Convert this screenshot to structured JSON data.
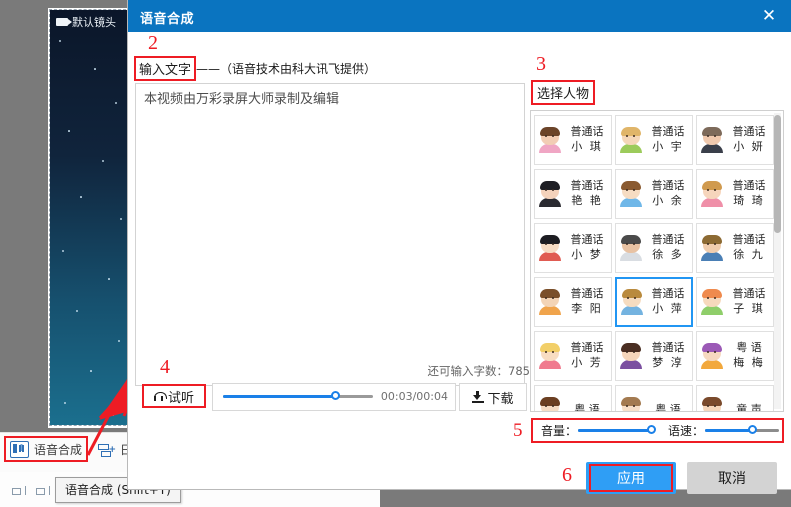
{
  "background": {
    "camera_label": "默认镜头",
    "toolbar": {
      "tts_label": "语音合成",
      "subtitle_label": "日",
      "tooltip": "语音合成 (Shift+T)"
    }
  },
  "dialog": {
    "title": "语音合成",
    "close_icon": "✕",
    "markers": {
      "m2": "2",
      "m3": "3",
      "m4": "4",
      "m5": "5",
      "m6": "6"
    },
    "input_section": {
      "label": "输入文字",
      "label_rest": "——（语音技术由科大讯飞提供）",
      "text_value": "本视频由万彩录屏大师录制及编辑",
      "placeholder": "",
      "char_count_label": "还可输入字数：785"
    },
    "audio": {
      "preview_label": "试听",
      "time_text": "00:03/00:04",
      "download_label": "下载",
      "seek_percent": 75
    },
    "character_section": {
      "label": "选择人物",
      "selected": "小萍",
      "items": [
        {
          "lang": "普通话",
          "name": "小 琪",
          "skin": "#f2cdb5",
          "hair": "#6b4429",
          "cloth": "#f0a6c4",
          "sel": false
        },
        {
          "lang": "普通话",
          "name": "小 宇",
          "skin": "#f5d7b8",
          "hair": "#e0b569",
          "cloth": "#9ccb5b",
          "sel": false
        },
        {
          "lang": "普通话",
          "name": "小 妍",
          "skin": "#f0c9ae",
          "hair": "#7d6a5a",
          "cloth": "#3a3f4a",
          "sel": false
        },
        {
          "lang": "普通话",
          "name": "艳 艳",
          "skin": "#f4d2bb",
          "hair": "#1e1e24",
          "cloth": "#2a2a30",
          "sel": false
        },
        {
          "lang": "普通话",
          "name": "小 余",
          "skin": "#f6dcc2",
          "hair": "#8a5a30",
          "cloth": "#6fb7e8",
          "sel": false
        },
        {
          "lang": "普通话",
          "name": "琦 琦",
          "skin": "#f6d5bc",
          "hair": "#d09a4e",
          "cloth": "#ef8fa8",
          "sel": false
        },
        {
          "lang": "普通话",
          "name": "小 梦",
          "skin": "#f7dcc4",
          "hair": "#1d1d22",
          "cloth": "#e05b52",
          "sel": false
        },
        {
          "lang": "普通话",
          "name": "徐 多",
          "skin": "#e8c2a3",
          "hair": "#4a4a4a",
          "cloth": "#d9dde2",
          "sel": false
        },
        {
          "lang": "普通话",
          "name": "徐 九",
          "skin": "#f0cdae",
          "hair": "#8c6a33",
          "cloth": "#4a7fb5",
          "sel": false
        },
        {
          "lang": "普通话",
          "name": "李 阳",
          "skin": "#f3d4b6",
          "hair": "#7a4f2a",
          "cloth": "#f0a44c",
          "sel": false
        },
        {
          "lang": "普通话",
          "name": "小 萍",
          "skin": "#f6dcc0",
          "hair": "#b98a3d",
          "cloth": "#74b3e0",
          "sel": true
        },
        {
          "lang": "普通话",
          "name": "子 琪",
          "skin": "#f7d9bd",
          "hair": "#ef8a4d",
          "cloth": "#8fce6a",
          "sel": false
        },
        {
          "lang": "普通话",
          "name": "小 芳",
          "skin": "#f8ddc2",
          "hair": "#f2cf68",
          "cloth": "#f07a8e",
          "sel": false
        },
        {
          "lang": "普通话",
          "name": "梦 淳",
          "skin": "#f5d6bb",
          "hair": "#4a2e22",
          "cloth": "#7b4fa0",
          "sel": false
        },
        {
          "lang": "粤 语",
          "name": "梅 梅",
          "skin": "#f6d9c0",
          "hair": "#9b59b6",
          "cloth": "#f2a83c",
          "sel": false
        },
        {
          "lang": "粤 语",
          "name": "",
          "skin": "#f6dcc4",
          "hair": "#6b3f22",
          "cloth": "#ffffff",
          "sel": false
        },
        {
          "lang": "粤 语",
          "name": "",
          "skin": "#f7dfc8",
          "hair": "#a37a50",
          "cloth": "#ffffff",
          "sel": false
        },
        {
          "lang": "童 声",
          "name": "",
          "skin": "#f5d6bb",
          "hair": "#7a4a2c",
          "cloth": "#ffffff",
          "sel": false
        }
      ]
    },
    "sliders": {
      "volume_label": "音量：",
      "volume_percent": 100,
      "speed_label": "语速：",
      "speed_percent": 65
    },
    "buttons": {
      "apply_label": "应用",
      "cancel_label": "取消"
    }
  },
  "colors": {
    "accent": "#0a74c0",
    "marker_red": "#ee1c24",
    "apply_blue": "#2f9ef5",
    "slider_blue": "#1a80e8",
    "select_blue": "#2196f3"
  }
}
